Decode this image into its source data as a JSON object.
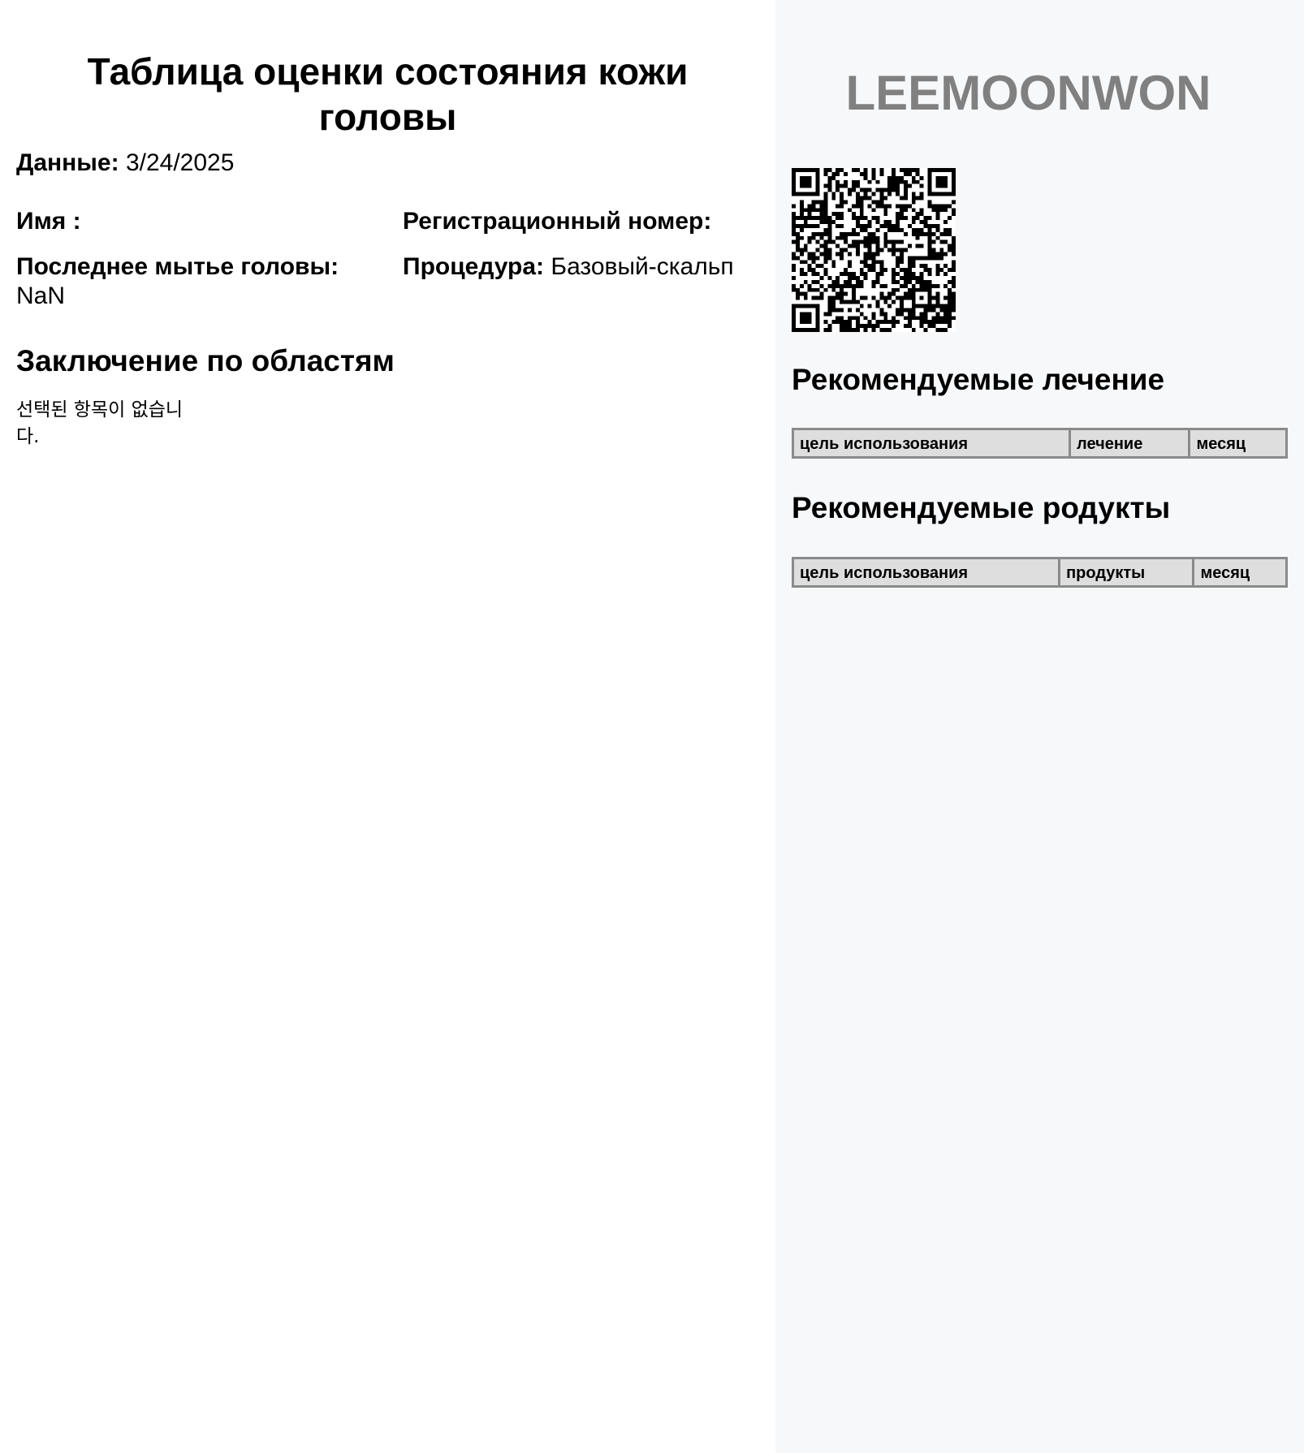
{
  "document": {
    "title": "Таблица оценки состояния кожи головы",
    "date_label": "Данные:",
    "date_value": "3/24/2025",
    "name_label": "Имя :",
    "registration_label": "Регистрационный номер:",
    "last_wash_label": "Последнее мытье головы:",
    "last_wash_value": "NaN",
    "procedure_label": "Процедура:",
    "procedure_value": "Базовый-скальп"
  },
  "areas": {
    "title": "Заключение по областям",
    "empty_message": "선택된 항목이 없습니다."
  },
  "brand": {
    "name": "LEEMOONWON"
  },
  "qr_code": {
    "icon": "qr-code-icon"
  },
  "recommended_treatments": {
    "title": "Рекомендуемые лечение",
    "columns": [
      "цель использования",
      "лечение",
      "месяц"
    ]
  },
  "recommended_products": {
    "title": "Рекомендуемые родукты",
    "columns": [
      "цель использования",
      "продукты",
      "месяц"
    ]
  },
  "colors": {
    "sidebar_background": "#f7f8fa",
    "brand_text": "#808080",
    "table_header_background": "#dedede",
    "table_border": "#8a8a8a"
  }
}
